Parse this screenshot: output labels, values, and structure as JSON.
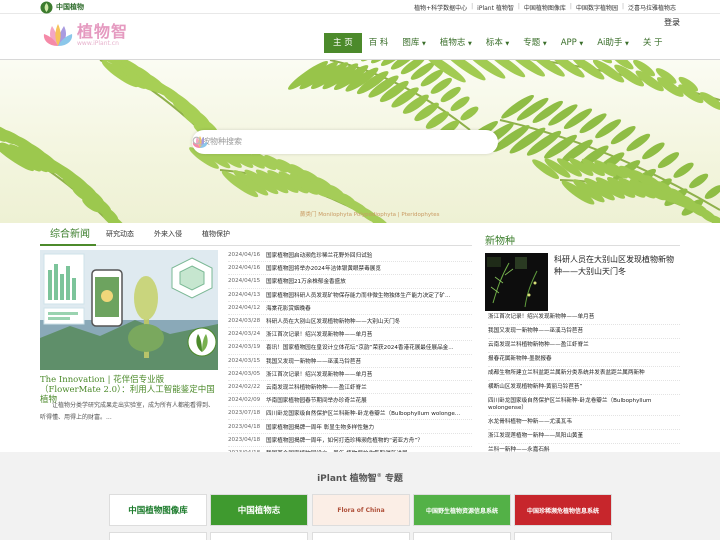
{
  "topbar": {
    "brand": "中国植物",
    "links": [
      "植物+科学数据中心",
      "iPlant 植物智",
      "中国植物图像库",
      "中国数字植物园",
      "泛喜马拉雅植物志"
    ]
  },
  "header": {
    "logo_cn": "植物智",
    "logo_url": "www.iPlant.cn",
    "login": "登录"
  },
  "nav": {
    "items": [
      {
        "label": "主 页",
        "active": true,
        "dropdown": false
      },
      {
        "label": "百 科",
        "active": false,
        "dropdown": false
      },
      {
        "label": "图库",
        "active": false,
        "dropdown": true
      },
      {
        "label": "植物志",
        "active": false,
        "dropdown": true
      },
      {
        "label": "标本",
        "active": false,
        "dropdown": true
      },
      {
        "label": "专题",
        "active": false,
        "dropdown": true
      },
      {
        "label": "APP",
        "active": false,
        "dropdown": true
      },
      {
        "label": "Ai助手",
        "active": false,
        "dropdown": true
      },
      {
        "label": "关 于",
        "active": false,
        "dropdown": false
      }
    ]
  },
  "search": {
    "placeholder": "按物种搜索"
  },
  "banner": {
    "caption": "蕨类门 Monilophyta Polypodiophyta | Pteridophytes"
  },
  "news": {
    "tabs": [
      "综合新闻",
      "研究动态",
      "外来入侵",
      "植物保护"
    ],
    "feature_title": "The Innovation | 花伴侣专业版（FlowerMate 2.0）：利用人工智能鉴定中国植物",
    "feature_desc": "让植物分类学研究成果走出实验室，成为所有人都能看得到、听得懂、用得上的财富。...",
    "items": [
      {
        "date": "2024/04/16",
        "title": "国家植物园启动濒危珍稀兰花野外回归试验"
      },
      {
        "date": "2024/04/16",
        "title": "国家植物园将举办2024年洁体银黄眼禁毒展览"
      },
      {
        "date": "2024/04/15",
        "title": "国家植物园21万余株郁金香盛放"
      },
      {
        "date": "2024/04/13",
        "title": "国家植物园科研人员发现矿物保存能力而非微生物独体生产能力决定了矿..."
      },
      {
        "date": "2024/04/12",
        "title": "海棠花影赏姻晚春"
      },
      {
        "date": "2024/03/28",
        "title": "科研人员在大别山区发现植物新物种——大别山天门冬"
      },
      {
        "date": "2024/03/24",
        "title": "浙江首次记录！绍兴发现新物种——单月苔"
      },
      {
        "date": "2024/03/19",
        "title": "喜讯！国家植物园在皇设计立体花坛“京韵”荣获2024香港花展最佳展品金..."
      },
      {
        "date": "2024/03/15",
        "title": "我国又发现一新物种——巫溪马铃苣苔"
      },
      {
        "date": "2024/03/05",
        "title": "浙江首次记录！绍兴发现新物种——单月苔"
      },
      {
        "date": "2024/02/22",
        "title": "云南发现兰科植物新物种——盈江虾脊兰"
      },
      {
        "date": "2024/02/09",
        "title": "华南国家植物园春节期间举办珍奇兰花展"
      },
      {
        "date": "2023/07/18",
        "title": "四川卧龙国家级自然保护区兰科新种-卧龙卷瓣兰（Bulbophyllum wolonge..."
      },
      {
        "date": "2023/04/18",
        "title": "国家植物园揭牌一周年 彰显生物多样性魅力"
      },
      {
        "date": "2023/04/18",
        "title": "国家植物园揭牌一周年，如何打造珍稀濒危植物的“诺亚方舟”？"
      },
      {
        "date": "2023/04/18",
        "title": "我国首个国家植物园设立一周年 植物保护收集取得新进展"
      }
    ]
  },
  "new_species": {
    "heading": "新物种",
    "feature": "科研人员在大别山区发现植物新物种——大别山天门冬",
    "items": [
      "浙江首次记录！绍兴发现新物种——单月苔",
      "我国又发现一新物种——巫溪马铃苣苔",
      "云南发现兰科植物新物种——盈江虾脊兰",
      "报春花属新物种-墨脱报春",
      "成都生物所建立兰科盆距兰属新分类系统并发表盆距兰属两新种",
      "横断山区发现植物新种-黄丽马铃苣苔”",
      "四川卧龙国家级自然保护区兰科新种-卧龙卷瓣兰（Bulbophyllum wolongense）",
      "水龙骨科植物一种新——尤溪瓦韦",
      "浙江发现莲植物一新种——凤阳山黄堇",
      "兰科一新种——永嘉石斛"
    ]
  },
  "topics": {
    "heading_prefix": "iPlant 植物智",
    "heading_sup": "®",
    "heading_suffix": " 专题",
    "tiles": [
      {
        "label": "中国植物图像库",
        "bg": "#ffffff",
        "fg": "#1a7a2a"
      },
      {
        "label": "中国植物志",
        "bg": "#3f9a2f",
        "fg": "#ffffff"
      },
      {
        "label": "Flora of China",
        "bg": "#fbeee6",
        "fg": "#b0523c"
      },
      {
        "label": "中国野生植物资源信息系统",
        "bg": "#53b147",
        "fg": "#ffffff"
      },
      {
        "label": "中国珍稀濒危植物信息系统",
        "bg": "#c7262c",
        "fg": "#ffffff"
      }
    ]
  },
  "colors": {
    "accent_green": "#4c8a2b",
    "logo_pink": "#e59ac0"
  }
}
